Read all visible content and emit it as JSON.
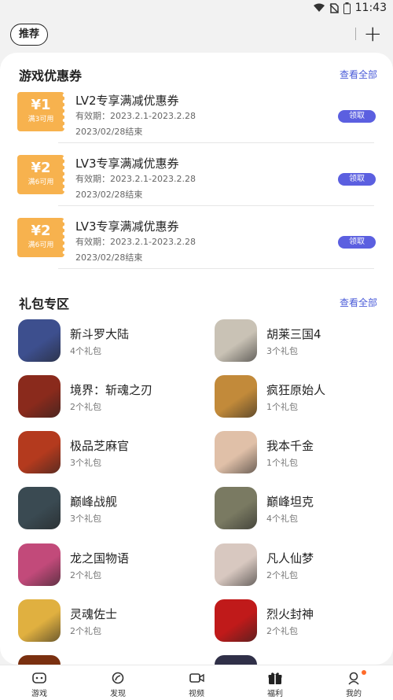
{
  "status": {
    "time": "11:43",
    "battery_label": "1"
  },
  "top": {
    "tag": "推荐"
  },
  "coupons": {
    "title": "游戏优惠券",
    "view_all": "查看全部",
    "items": [
      {
        "amount": "¥1",
        "cond": "满3可用",
        "title": "LV2专享满减优惠券",
        "valid": "有效期：2023.2.1-2023.2.28",
        "end": "2023/02/28结束",
        "btn": "领取"
      },
      {
        "amount": "¥2",
        "cond": "满6可用",
        "title": "LV3专享满减优惠券",
        "valid": "有效期：2023.2.1-2023.2.28",
        "end": "2023/02/28结束",
        "btn": "领取"
      },
      {
        "amount": "¥2",
        "cond": "满6可用",
        "title": "LV3专享满减优惠券",
        "valid": "有效期：2023.2.1-2023.2.28",
        "end": "2023/02/28结束",
        "btn": "领取"
      }
    ]
  },
  "gifts": {
    "title": "礼包专区",
    "view_all": "查看全部",
    "items": [
      {
        "name": "新斗罗大陆",
        "count": "4个礼包"
      },
      {
        "name": "胡莱三国4",
        "count": "3个礼包"
      },
      {
        "name": "境界：斩魂之刃",
        "count": "2个礼包"
      },
      {
        "name": "疯狂原始人",
        "count": "1个礼包"
      },
      {
        "name": "极品芝麻官",
        "count": "3个礼包"
      },
      {
        "name": "我本千金",
        "count": "1个礼包"
      },
      {
        "name": "巅峰战舰",
        "count": "3个礼包"
      },
      {
        "name": "巅峰坦克",
        "count": "4个礼包"
      },
      {
        "name": "龙之国物语",
        "count": "2个礼包"
      },
      {
        "name": "凡人仙梦",
        "count": "2个礼包"
      },
      {
        "name": "灵魂佐士",
        "count": "2个礼包"
      },
      {
        "name": "烈火封神",
        "count": "2个礼包"
      }
    ],
    "icon_colors": [
      "#3d4f8e",
      "#c9c2b5",
      "#8a2a1c",
      "#c28a3a",
      "#b43a1e",
      "#e0c0a8",
      "#3a4a52",
      "#7a7a62",
      "#c24a7a",
      "#d8c8c0",
      "#e0b040",
      "#c01a1a",
      "#7a3010",
      "#303048"
    ]
  },
  "tabs": [
    {
      "label": "游戏",
      "icon": "gamepad-icon"
    },
    {
      "label": "发现",
      "icon": "compass-icon"
    },
    {
      "label": "视频",
      "icon": "video-icon"
    },
    {
      "label": "福利",
      "icon": "gift-icon"
    },
    {
      "label": "我的",
      "icon": "user-icon"
    }
  ],
  "colors": {
    "accent": "#5b5fe0",
    "link": "#4a5bd8",
    "coupon": "#f7b24e",
    "badge": "#ff6a2a"
  }
}
